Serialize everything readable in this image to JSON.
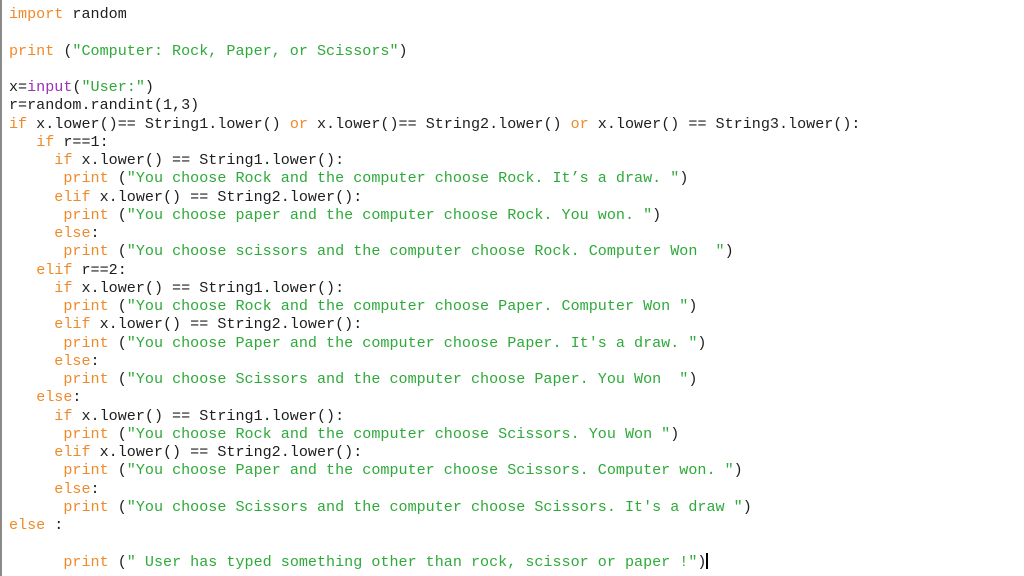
{
  "editor": {
    "language": "python",
    "colors": {
      "keyword": "#ef8a2a",
      "string": "#2eaa3a",
      "builtin": "#9b2fb7",
      "text": "#1e1e1e"
    },
    "lines": [
      [
        {
          "t": "kw",
          "v": "import"
        },
        {
          "t": "plain",
          "v": " random"
        }
      ],
      [],
      [
        {
          "t": "kw",
          "v": "print"
        },
        {
          "t": "plain",
          "v": " ("
        },
        {
          "t": "str",
          "v": "\"Computer: Rock, Paper, or Scissors\""
        },
        {
          "t": "plain",
          "v": ")"
        }
      ],
      [],
      [
        {
          "t": "plain",
          "v": "x="
        },
        {
          "t": "bi",
          "v": "input"
        },
        {
          "t": "plain",
          "v": "("
        },
        {
          "t": "str",
          "v": "\"User:\""
        },
        {
          "t": "plain",
          "v": ")"
        }
      ],
      [
        {
          "t": "plain",
          "v": "r=random.randint(1,3)"
        }
      ],
      [
        {
          "t": "kw",
          "v": "if"
        },
        {
          "t": "plain",
          "v": " x.lower()== String1.lower() "
        },
        {
          "t": "kw",
          "v": "or"
        },
        {
          "t": "plain",
          "v": " x.lower()== String2.lower() "
        },
        {
          "t": "kw",
          "v": "or"
        },
        {
          "t": "plain",
          "v": " x.lower() == String3.lower():"
        }
      ],
      [
        {
          "t": "plain",
          "v": "   "
        },
        {
          "t": "kw",
          "v": "if"
        },
        {
          "t": "plain",
          "v": " r==1:"
        }
      ],
      [
        {
          "t": "plain",
          "v": "     "
        },
        {
          "t": "kw",
          "v": "if"
        },
        {
          "t": "plain",
          "v": " x.lower() == String1.lower():"
        }
      ],
      [
        {
          "t": "plain",
          "v": "      "
        },
        {
          "t": "kw",
          "v": "print"
        },
        {
          "t": "plain",
          "v": " ("
        },
        {
          "t": "str",
          "v": "\"You choose Rock and the computer choose Rock. It’s a draw. \""
        },
        {
          "t": "plain",
          "v": ")"
        }
      ],
      [
        {
          "t": "plain",
          "v": "     "
        },
        {
          "t": "kw",
          "v": "elif"
        },
        {
          "t": "plain",
          "v": " x.lower() == String2.lower():"
        }
      ],
      [
        {
          "t": "plain",
          "v": "      "
        },
        {
          "t": "kw",
          "v": "print"
        },
        {
          "t": "plain",
          "v": " ("
        },
        {
          "t": "str",
          "v": "\"You choose paper and the computer choose Rock. You won. \""
        },
        {
          "t": "plain",
          "v": ")"
        }
      ],
      [
        {
          "t": "plain",
          "v": "     "
        },
        {
          "t": "kw",
          "v": "else"
        },
        {
          "t": "plain",
          "v": ":"
        }
      ],
      [
        {
          "t": "plain",
          "v": "      "
        },
        {
          "t": "kw",
          "v": "print"
        },
        {
          "t": "plain",
          "v": " ("
        },
        {
          "t": "str",
          "v": "\"You choose scissors and the computer choose Rock. Computer Won  \""
        },
        {
          "t": "plain",
          "v": ")"
        }
      ],
      [
        {
          "t": "plain",
          "v": "   "
        },
        {
          "t": "kw",
          "v": "elif"
        },
        {
          "t": "plain",
          "v": " r==2:"
        }
      ],
      [
        {
          "t": "plain",
          "v": "     "
        },
        {
          "t": "kw",
          "v": "if"
        },
        {
          "t": "plain",
          "v": " x.lower() == String1.lower():"
        }
      ],
      [
        {
          "t": "plain",
          "v": "      "
        },
        {
          "t": "kw",
          "v": "print"
        },
        {
          "t": "plain",
          "v": " ("
        },
        {
          "t": "str",
          "v": "\"You choose Rock and the computer choose Paper. Computer Won \""
        },
        {
          "t": "plain",
          "v": ")"
        }
      ],
      [
        {
          "t": "plain",
          "v": "     "
        },
        {
          "t": "kw",
          "v": "elif"
        },
        {
          "t": "plain",
          "v": " x.lower() == String2.lower():"
        }
      ],
      [
        {
          "t": "plain",
          "v": "      "
        },
        {
          "t": "kw",
          "v": "print"
        },
        {
          "t": "plain",
          "v": " ("
        },
        {
          "t": "str",
          "v": "\"You choose Paper and the computer choose Paper. It's a draw. \""
        },
        {
          "t": "plain",
          "v": ")"
        }
      ],
      [
        {
          "t": "plain",
          "v": "     "
        },
        {
          "t": "kw",
          "v": "else"
        },
        {
          "t": "plain",
          "v": ":"
        }
      ],
      [
        {
          "t": "plain",
          "v": "      "
        },
        {
          "t": "kw",
          "v": "print"
        },
        {
          "t": "plain",
          "v": " ("
        },
        {
          "t": "str",
          "v": "\"You choose Scissors and the computer choose Paper. You Won  \""
        },
        {
          "t": "plain",
          "v": ")"
        }
      ],
      [
        {
          "t": "plain",
          "v": "   "
        },
        {
          "t": "kw",
          "v": "else"
        },
        {
          "t": "plain",
          "v": ":"
        }
      ],
      [
        {
          "t": "plain",
          "v": "     "
        },
        {
          "t": "kw",
          "v": "if"
        },
        {
          "t": "plain",
          "v": " x.lower() == String1.lower():"
        }
      ],
      [
        {
          "t": "plain",
          "v": "      "
        },
        {
          "t": "kw",
          "v": "print"
        },
        {
          "t": "plain",
          "v": " ("
        },
        {
          "t": "str",
          "v": "\"You choose Rock and the computer choose Scissors. You Won \""
        },
        {
          "t": "plain",
          "v": ")"
        }
      ],
      [
        {
          "t": "plain",
          "v": "     "
        },
        {
          "t": "kw",
          "v": "elif"
        },
        {
          "t": "plain",
          "v": " x.lower() == String2.lower():"
        }
      ],
      [
        {
          "t": "plain",
          "v": "      "
        },
        {
          "t": "kw",
          "v": "print"
        },
        {
          "t": "plain",
          "v": " ("
        },
        {
          "t": "str",
          "v": "\"You choose Paper and the computer choose Scissors. Computer won. \""
        },
        {
          "t": "plain",
          "v": ")"
        }
      ],
      [
        {
          "t": "plain",
          "v": "     "
        },
        {
          "t": "kw",
          "v": "else"
        },
        {
          "t": "plain",
          "v": ":"
        }
      ],
      [
        {
          "t": "plain",
          "v": "      "
        },
        {
          "t": "kw",
          "v": "print"
        },
        {
          "t": "plain",
          "v": " ("
        },
        {
          "t": "str",
          "v": "\"You choose Scissors and the computer choose Scissors. It's a draw \""
        },
        {
          "t": "plain",
          "v": ")"
        }
      ],
      [
        {
          "t": "kw",
          "v": "else"
        },
        {
          "t": "plain",
          "v": " :"
        }
      ],
      [],
      [
        {
          "t": "plain",
          "v": "      "
        },
        {
          "t": "kw",
          "v": "print"
        },
        {
          "t": "plain",
          "v": " ("
        },
        {
          "t": "str",
          "v": "\" User has typed something other than rock, scissor or paper !\""
        },
        {
          "t": "plain",
          "v": ")"
        },
        {
          "t": "caret",
          "v": ""
        }
      ]
    ]
  }
}
